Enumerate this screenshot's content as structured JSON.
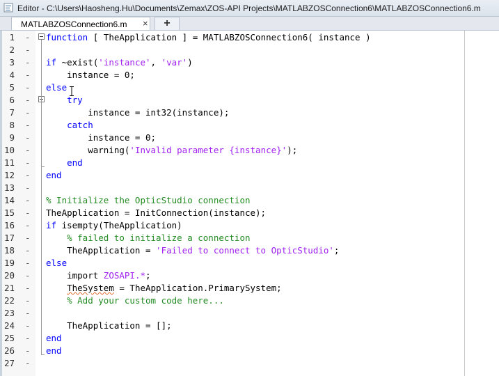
{
  "window": {
    "title": "Editor - C:\\Users\\Haosheng.Hu\\Documents\\Zemax\\ZOS-API Projects\\MATLABZOSConnection6\\MATLABZOSConnection6.m",
    "app_icon": "matlab-editor-icon"
  },
  "tabs": [
    {
      "label": "MATLABZOSConnection6.m",
      "close": "×"
    }
  ],
  "tab_add": "+",
  "code_lines": [
    {
      "n": "1",
      "segments": [
        [
          "kw",
          "function"
        ],
        [
          "t",
          " [ TheApplication ] = MATLABZOSConnection6( instance )"
        ]
      ]
    },
    {
      "n": "2",
      "segments": []
    },
    {
      "n": "3",
      "segments": [
        [
          "kw",
          "if"
        ],
        [
          "t",
          " ~exist("
        ],
        [
          "str",
          "'instance'"
        ],
        [
          "t",
          ", "
        ],
        [
          "str",
          "'var'"
        ],
        [
          "t",
          ")"
        ]
      ]
    },
    {
      "n": "4",
      "segments": [
        [
          "t",
          "    instance = 0;"
        ]
      ]
    },
    {
      "n": "5",
      "segments": [
        [
          "kw",
          "else"
        ]
      ]
    },
    {
      "n": "6",
      "segments": [
        [
          "t",
          "    "
        ],
        [
          "kw",
          "try"
        ]
      ]
    },
    {
      "n": "7",
      "segments": [
        [
          "t",
          "        instance = int32(instance);"
        ]
      ]
    },
    {
      "n": "8",
      "segments": [
        [
          "t",
          "    "
        ],
        [
          "kw",
          "catch"
        ]
      ]
    },
    {
      "n": "9",
      "segments": [
        [
          "t",
          "        instance = 0;"
        ]
      ]
    },
    {
      "n": "10",
      "segments": [
        [
          "t",
          "        warning("
        ],
        [
          "str",
          "'Invalid parameter {instance}'"
        ],
        [
          "t",
          ");"
        ]
      ]
    },
    {
      "n": "11",
      "segments": [
        [
          "t",
          "    "
        ],
        [
          "kw",
          "end"
        ]
      ]
    },
    {
      "n": "12",
      "segments": [
        [
          "kw",
          "end"
        ]
      ]
    },
    {
      "n": "13",
      "segments": []
    },
    {
      "n": "14",
      "segments": [
        [
          "com",
          "% Initialize the OpticStudio connection"
        ]
      ]
    },
    {
      "n": "15",
      "segments": [
        [
          "t",
          "TheApplication = InitConnection(instance);"
        ]
      ]
    },
    {
      "n": "16",
      "segments": [
        [
          "kw",
          "if"
        ],
        [
          "t",
          " isempty(TheApplication)"
        ]
      ]
    },
    {
      "n": "17",
      "segments": [
        [
          "t",
          "    "
        ],
        [
          "com",
          "% failed to initialize a connection"
        ]
      ]
    },
    {
      "n": "18",
      "segments": [
        [
          "t",
          "    TheApplication = "
        ],
        [
          "str",
          "'Failed to connect to OpticStudio'"
        ],
        [
          "t",
          ";"
        ]
      ]
    },
    {
      "n": "19",
      "segments": [
        [
          "kw",
          "else"
        ]
      ]
    },
    {
      "n": "20",
      "segments": [
        [
          "t",
          "    import "
        ],
        [
          "str",
          "ZOSAPI.*"
        ],
        [
          "t",
          ";"
        ]
      ]
    },
    {
      "n": "21",
      "segments": [
        [
          "t",
          "    "
        ],
        [
          "sq",
          "TheSystem"
        ],
        [
          "t",
          " = TheApplication.PrimarySystem;"
        ]
      ]
    },
    {
      "n": "22",
      "segments": [
        [
          "t",
          "    "
        ],
        [
          "com",
          "% Add your custom code here..."
        ]
      ]
    },
    {
      "n": "23",
      "segments": []
    },
    {
      "n": "24",
      "segments": [
        [
          "t",
          "    TheApplication = [];"
        ]
      ]
    },
    {
      "n": "25",
      "segments": [
        [
          "kw",
          "end"
        ]
      ]
    },
    {
      "n": "26",
      "segments": [
        [
          "kw",
          "end"
        ]
      ]
    },
    {
      "n": "27",
      "segments": []
    }
  ],
  "colors": {
    "keyword": "#0000ff",
    "string": "#a020f0",
    "comment": "#228b22",
    "warning_underline": "#e26b2f"
  },
  "icons": {
    "fold": "fold-minus-icon",
    "cursor": "text-cursor-icon",
    "close": "close-icon",
    "add": "add-tab-icon"
  }
}
